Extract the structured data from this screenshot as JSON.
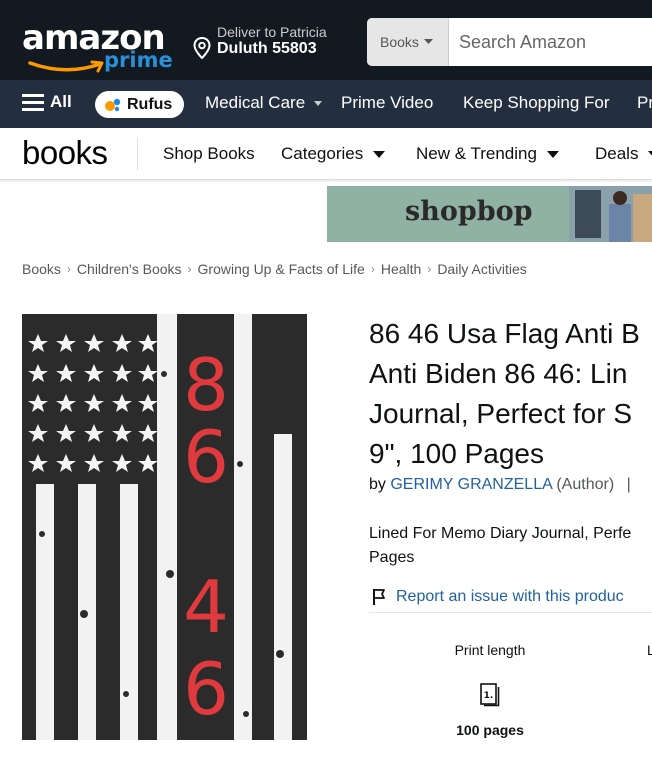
{
  "header": {
    "logo_wordmark": "amazon",
    "logo_sub": "prime",
    "deliver_label": "Deliver to Patricia",
    "deliver_location": "Duluth 55803",
    "search_dept": "Books",
    "search_placeholder": "Search Amazon"
  },
  "nav": {
    "all_label": "All",
    "rufus_label": "Rufus",
    "items": [
      "Medical Care",
      "Prime Video",
      "Keep Shopping For",
      "Pr"
    ]
  },
  "books_nav": {
    "logo": "books",
    "links": [
      "Shop Books",
      "Categories",
      "New & Trending",
      "Deals"
    ]
  },
  "ad": {
    "text": "shopbop"
  },
  "breadcrumb": [
    "Books",
    "Children's Books",
    "Growing Up & Facts of Life",
    "Health",
    "Daily Activities"
  ],
  "product": {
    "cover_digits": [
      "8",
      "6",
      "4",
      "6"
    ],
    "title": "86 46 Usa Flag Anti B\nAnti Biden 86 46: Lin\nJournal, Perfect for S\n9\", 100 Pages",
    "by_prefix": "by",
    "author": "GERIMY GRANZELLA",
    "author_role": "(Author)",
    "description": "Lined For Memo Diary Journal, Perfe\nPages",
    "report_link": "Report an issue with this produc",
    "specs": [
      {
        "label": "Print length",
        "value": "100 pages",
        "icon": "book-pages-icon"
      },
      {
        "label": "L"
      }
    ]
  },
  "colors": {
    "header_bg": "#131921",
    "nav_bg": "#232f3e",
    "prime_blue": "#2a8fd6",
    "link_blue": "#2162a1",
    "cover_red": "#e03a3e"
  }
}
